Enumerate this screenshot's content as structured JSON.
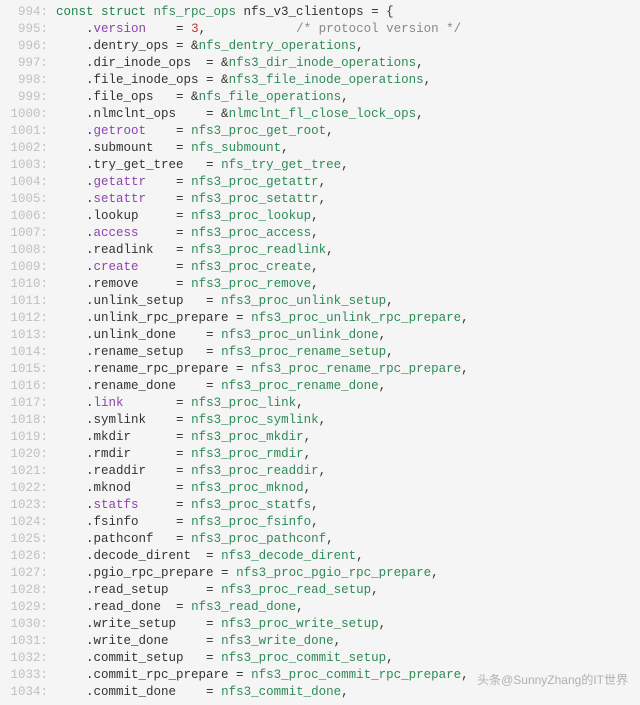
{
  "watermark": "头条@SunnyZhang的IT世界",
  "lines": [
    {
      "n": 994,
      "indent": 0,
      "tokens": [
        {
          "t": "const ",
          "c": "kw"
        },
        {
          "t": "struct ",
          "c": "kw"
        },
        {
          "t": "nfs_rpc_ops ",
          "c": "type"
        },
        {
          "t": "nfs_v3_clientops = {",
          "c": "punct"
        }
      ]
    },
    {
      "n": 995,
      "indent": 1,
      "tokens": [
        {
          "t": ".",
          "c": "punct"
        },
        {
          "t": "version",
          "c": "member"
        },
        {
          "t": "    = ",
          "c": "punct"
        },
        {
          "t": "3",
          "c": "num"
        },
        {
          "t": ",",
          "c": "punct"
        },
        {
          "t": "            ",
          "c": "punct"
        },
        {
          "t": "/* protocol version */",
          "c": "cmt"
        }
      ]
    },
    {
      "n": 996,
      "indent": 1,
      "tokens": [
        {
          "t": ".",
          "c": "punct"
        },
        {
          "t": "dentry_ops = &",
          "c": "punct"
        },
        {
          "t": "nfs_dentry_operations",
          "c": "type"
        },
        {
          "t": ",",
          "c": "punct"
        }
      ]
    },
    {
      "n": 997,
      "indent": 1,
      "tokens": [
        {
          "t": ".",
          "c": "punct"
        },
        {
          "t": "dir_inode_ops  = &",
          "c": "punct"
        },
        {
          "t": "nfs3_dir_inode_operations",
          "c": "type"
        },
        {
          "t": ",",
          "c": "punct"
        }
      ]
    },
    {
      "n": 998,
      "indent": 1,
      "tokens": [
        {
          "t": ".",
          "c": "punct"
        },
        {
          "t": "file_inode_ops = &",
          "c": "punct"
        },
        {
          "t": "nfs3_file_inode_operations",
          "c": "type"
        },
        {
          "t": ",",
          "c": "punct"
        }
      ]
    },
    {
      "n": 999,
      "indent": 1,
      "tokens": [
        {
          "t": ".",
          "c": "punct"
        },
        {
          "t": "file_ops   = &",
          "c": "punct"
        },
        {
          "t": "nfs_file_operations",
          "c": "type"
        },
        {
          "t": ",",
          "c": "punct"
        }
      ]
    },
    {
      "n": 1000,
      "indent": 1,
      "tokens": [
        {
          "t": ".",
          "c": "punct"
        },
        {
          "t": "nlmclnt_ops    = &",
          "c": "punct"
        },
        {
          "t": "nlmclnt_fl_close_lock_ops",
          "c": "type"
        },
        {
          "t": ",",
          "c": "punct"
        }
      ]
    },
    {
      "n": 1001,
      "indent": 1,
      "tokens": [
        {
          "t": ".",
          "c": "punct"
        },
        {
          "t": "getroot",
          "c": "member"
        },
        {
          "t": "    = ",
          "c": "punct"
        },
        {
          "t": "nfs3_proc_get_root",
          "c": "type"
        },
        {
          "t": ",",
          "c": "punct"
        }
      ]
    },
    {
      "n": 1002,
      "indent": 1,
      "tokens": [
        {
          "t": ".",
          "c": "punct"
        },
        {
          "t": "submount   = ",
          "c": "punct"
        },
        {
          "t": "nfs_submount",
          "c": "type"
        },
        {
          "t": ",",
          "c": "punct"
        }
      ]
    },
    {
      "n": 1003,
      "indent": 1,
      "tokens": [
        {
          "t": ".",
          "c": "punct"
        },
        {
          "t": "try_get_tree   = ",
          "c": "punct"
        },
        {
          "t": "nfs_try_get_tree",
          "c": "type"
        },
        {
          "t": ",",
          "c": "punct"
        }
      ]
    },
    {
      "n": 1004,
      "indent": 1,
      "tokens": [
        {
          "t": ".",
          "c": "punct"
        },
        {
          "t": "getattr",
          "c": "member"
        },
        {
          "t": "    = ",
          "c": "punct"
        },
        {
          "t": "nfs3_proc_getattr",
          "c": "type"
        },
        {
          "t": ",",
          "c": "punct"
        }
      ]
    },
    {
      "n": 1005,
      "indent": 1,
      "tokens": [
        {
          "t": ".",
          "c": "punct"
        },
        {
          "t": "setattr",
          "c": "member"
        },
        {
          "t": "    = ",
          "c": "punct"
        },
        {
          "t": "nfs3_proc_setattr",
          "c": "type"
        },
        {
          "t": ",",
          "c": "punct"
        }
      ]
    },
    {
      "n": 1006,
      "indent": 1,
      "tokens": [
        {
          "t": ".",
          "c": "punct"
        },
        {
          "t": "lookup     = ",
          "c": "punct"
        },
        {
          "t": "nfs3_proc_lookup",
          "c": "type"
        },
        {
          "t": ",",
          "c": "punct"
        }
      ]
    },
    {
      "n": 1007,
      "indent": 1,
      "tokens": [
        {
          "t": ".",
          "c": "punct"
        },
        {
          "t": "access",
          "c": "member"
        },
        {
          "t": "     = ",
          "c": "punct"
        },
        {
          "t": "nfs3_proc_access",
          "c": "type"
        },
        {
          "t": ",",
          "c": "punct"
        }
      ]
    },
    {
      "n": 1008,
      "indent": 1,
      "tokens": [
        {
          "t": ".",
          "c": "punct"
        },
        {
          "t": "readlink   = ",
          "c": "punct"
        },
        {
          "t": "nfs3_proc_readlink",
          "c": "type"
        },
        {
          "t": ",",
          "c": "punct"
        }
      ]
    },
    {
      "n": 1009,
      "indent": 1,
      "tokens": [
        {
          "t": ".",
          "c": "punct"
        },
        {
          "t": "create",
          "c": "member"
        },
        {
          "t": "     = ",
          "c": "punct"
        },
        {
          "t": "nfs3_proc_create",
          "c": "type"
        },
        {
          "t": ",",
          "c": "punct"
        }
      ]
    },
    {
      "n": 1010,
      "indent": 1,
      "tokens": [
        {
          "t": ".",
          "c": "punct"
        },
        {
          "t": "remove     = ",
          "c": "punct"
        },
        {
          "t": "nfs3_proc_remove",
          "c": "type"
        },
        {
          "t": ",",
          "c": "punct"
        }
      ]
    },
    {
      "n": 1011,
      "indent": 1,
      "tokens": [
        {
          "t": ".",
          "c": "punct"
        },
        {
          "t": "unlink_setup   = ",
          "c": "punct"
        },
        {
          "t": "nfs3_proc_unlink_setup",
          "c": "type"
        },
        {
          "t": ",",
          "c": "punct"
        }
      ]
    },
    {
      "n": 1012,
      "indent": 1,
      "tokens": [
        {
          "t": ".",
          "c": "punct"
        },
        {
          "t": "unlink_rpc_prepare = ",
          "c": "punct"
        },
        {
          "t": "nfs3_proc_unlink_rpc_prepare",
          "c": "type"
        },
        {
          "t": ",",
          "c": "punct"
        }
      ]
    },
    {
      "n": 1013,
      "indent": 1,
      "tokens": [
        {
          "t": ".",
          "c": "punct"
        },
        {
          "t": "unlink_done    = ",
          "c": "punct"
        },
        {
          "t": "nfs3_proc_unlink_done",
          "c": "type"
        },
        {
          "t": ",",
          "c": "punct"
        }
      ]
    },
    {
      "n": 1014,
      "indent": 1,
      "tokens": [
        {
          "t": ".",
          "c": "punct"
        },
        {
          "t": "rename_setup   = ",
          "c": "punct"
        },
        {
          "t": "nfs3_proc_rename_setup",
          "c": "type"
        },
        {
          "t": ",",
          "c": "punct"
        }
      ]
    },
    {
      "n": 1015,
      "indent": 1,
      "tokens": [
        {
          "t": ".",
          "c": "punct"
        },
        {
          "t": "rename_rpc_prepare = ",
          "c": "punct"
        },
        {
          "t": "nfs3_proc_rename_rpc_prepare",
          "c": "type"
        },
        {
          "t": ",",
          "c": "punct"
        }
      ]
    },
    {
      "n": 1016,
      "indent": 1,
      "tokens": [
        {
          "t": ".",
          "c": "punct"
        },
        {
          "t": "rename_done    = ",
          "c": "punct"
        },
        {
          "t": "nfs3_proc_rename_done",
          "c": "type"
        },
        {
          "t": ",",
          "c": "punct"
        }
      ]
    },
    {
      "n": 1017,
      "indent": 1,
      "tokens": [
        {
          "t": ".",
          "c": "punct"
        },
        {
          "t": "link",
          "c": "member"
        },
        {
          "t": "       = ",
          "c": "punct"
        },
        {
          "t": "nfs3_proc_link",
          "c": "type"
        },
        {
          "t": ",",
          "c": "punct"
        }
      ]
    },
    {
      "n": 1018,
      "indent": 1,
      "tokens": [
        {
          "t": ".",
          "c": "punct"
        },
        {
          "t": "symlink    = ",
          "c": "punct"
        },
        {
          "t": "nfs3_proc_symlink",
          "c": "type"
        },
        {
          "t": ",",
          "c": "punct"
        }
      ]
    },
    {
      "n": 1019,
      "indent": 1,
      "tokens": [
        {
          "t": ".",
          "c": "punct"
        },
        {
          "t": "mkdir      = ",
          "c": "punct"
        },
        {
          "t": "nfs3_proc_mkdir",
          "c": "type"
        },
        {
          "t": ",",
          "c": "punct"
        }
      ]
    },
    {
      "n": 1020,
      "indent": 1,
      "tokens": [
        {
          "t": ".",
          "c": "punct"
        },
        {
          "t": "rmdir      = ",
          "c": "punct"
        },
        {
          "t": "nfs3_proc_rmdir",
          "c": "type"
        },
        {
          "t": ",",
          "c": "punct"
        }
      ]
    },
    {
      "n": 1021,
      "indent": 1,
      "tokens": [
        {
          "t": ".",
          "c": "punct"
        },
        {
          "t": "readdir    = ",
          "c": "punct"
        },
        {
          "t": "nfs3_proc_readdir",
          "c": "type"
        },
        {
          "t": ",",
          "c": "punct"
        }
      ]
    },
    {
      "n": 1022,
      "indent": 1,
      "tokens": [
        {
          "t": ".",
          "c": "punct"
        },
        {
          "t": "mknod      = ",
          "c": "punct"
        },
        {
          "t": "nfs3_proc_mknod",
          "c": "type"
        },
        {
          "t": ",",
          "c": "punct"
        }
      ]
    },
    {
      "n": 1023,
      "indent": 1,
      "tokens": [
        {
          "t": ".",
          "c": "punct"
        },
        {
          "t": "statfs",
          "c": "member"
        },
        {
          "t": "     = ",
          "c": "punct"
        },
        {
          "t": "nfs3_proc_statfs",
          "c": "type"
        },
        {
          "t": ",",
          "c": "punct"
        }
      ]
    },
    {
      "n": 1024,
      "indent": 1,
      "tokens": [
        {
          "t": ".",
          "c": "punct"
        },
        {
          "t": "fsinfo     = ",
          "c": "punct"
        },
        {
          "t": "nfs3_proc_fsinfo",
          "c": "type"
        },
        {
          "t": ",",
          "c": "punct"
        }
      ]
    },
    {
      "n": 1025,
      "indent": 1,
      "tokens": [
        {
          "t": ".",
          "c": "punct"
        },
        {
          "t": "pathconf   = ",
          "c": "punct"
        },
        {
          "t": "nfs3_proc_pathconf",
          "c": "type"
        },
        {
          "t": ",",
          "c": "punct"
        }
      ]
    },
    {
      "n": 1026,
      "indent": 1,
      "tokens": [
        {
          "t": ".",
          "c": "punct"
        },
        {
          "t": "decode_dirent  = ",
          "c": "punct"
        },
        {
          "t": "nfs3_decode_dirent",
          "c": "type"
        },
        {
          "t": ",",
          "c": "punct"
        }
      ]
    },
    {
      "n": 1027,
      "indent": 1,
      "tokens": [
        {
          "t": ".",
          "c": "punct"
        },
        {
          "t": "pgio_rpc_prepare = ",
          "c": "punct"
        },
        {
          "t": "nfs3_proc_pgio_rpc_prepare",
          "c": "type"
        },
        {
          "t": ",",
          "c": "punct"
        }
      ]
    },
    {
      "n": 1028,
      "indent": 1,
      "tokens": [
        {
          "t": ".",
          "c": "punct"
        },
        {
          "t": "read_setup     = ",
          "c": "punct"
        },
        {
          "t": "nfs3_proc_read_setup",
          "c": "type"
        },
        {
          "t": ",",
          "c": "punct"
        }
      ]
    },
    {
      "n": 1029,
      "indent": 1,
      "tokens": [
        {
          "t": ".",
          "c": "punct"
        },
        {
          "t": "read_done  = ",
          "c": "punct"
        },
        {
          "t": "nfs3_read_done",
          "c": "type"
        },
        {
          "t": ",",
          "c": "punct"
        }
      ]
    },
    {
      "n": 1030,
      "indent": 1,
      "tokens": [
        {
          "t": ".",
          "c": "punct"
        },
        {
          "t": "write_setup    = ",
          "c": "punct"
        },
        {
          "t": "nfs3_proc_write_setup",
          "c": "type"
        },
        {
          "t": ",",
          "c": "punct"
        }
      ]
    },
    {
      "n": 1031,
      "indent": 1,
      "tokens": [
        {
          "t": ".",
          "c": "punct"
        },
        {
          "t": "write_done     = ",
          "c": "punct"
        },
        {
          "t": "nfs3_write_done",
          "c": "type"
        },
        {
          "t": ",",
          "c": "punct"
        }
      ]
    },
    {
      "n": 1032,
      "indent": 1,
      "tokens": [
        {
          "t": ".",
          "c": "punct"
        },
        {
          "t": "commit_setup   = ",
          "c": "punct"
        },
        {
          "t": "nfs3_proc_commit_setup",
          "c": "type"
        },
        {
          "t": ",",
          "c": "punct"
        }
      ]
    },
    {
      "n": 1033,
      "indent": 1,
      "tokens": [
        {
          "t": ".",
          "c": "punct"
        },
        {
          "t": "commit_rpc_prepare = ",
          "c": "punct"
        },
        {
          "t": "nfs3_proc_commit_rpc_prepare",
          "c": "type"
        },
        {
          "t": ",",
          "c": "punct"
        }
      ]
    },
    {
      "n": 1034,
      "indent": 1,
      "tokens": [
        {
          "t": ".",
          "c": "punct"
        },
        {
          "t": "commit_done    = ",
          "c": "punct"
        },
        {
          "t": "nfs3_commit_done",
          "c": "type"
        },
        {
          "t": ",",
          "c": "punct"
        }
      ]
    }
  ]
}
